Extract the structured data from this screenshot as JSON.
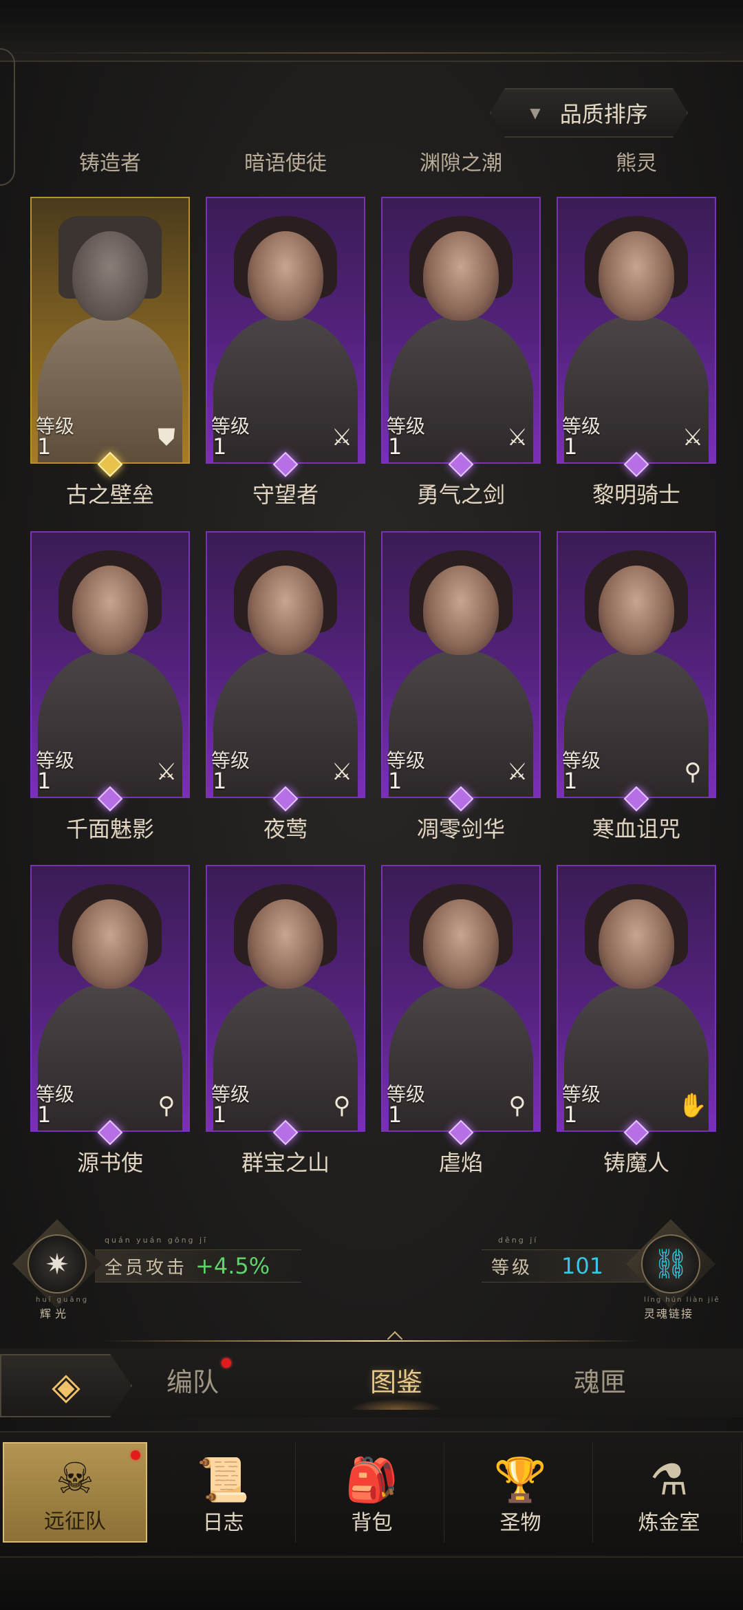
{
  "sort": {
    "label": "品质排序",
    "arrow": "▼"
  },
  "top_names": [
    "铸造者",
    "暗语使徒",
    "渊隙之潮",
    "熊灵"
  ],
  "heroes": [
    {
      "name": "古之壁垒",
      "level_label": "等级",
      "level": "1",
      "quality": "gold",
      "class_icon": "shield-icon",
      "glyph": "⛊"
    },
    {
      "name": "守望者",
      "level_label": "等级",
      "level": "1",
      "quality": "purple",
      "class_icon": "sword-icon",
      "glyph": "⚔"
    },
    {
      "name": "勇气之剑",
      "level_label": "等级",
      "level": "1",
      "quality": "purple",
      "class_icon": "sword-icon",
      "glyph": "⚔"
    },
    {
      "name": "黎明骑士",
      "level_label": "等级",
      "level": "1",
      "quality": "purple",
      "class_icon": "sword-icon",
      "glyph": "⚔"
    },
    {
      "name": "千面魅影",
      "level_label": "等级",
      "level": "1",
      "quality": "purple",
      "class_icon": "sword-icon",
      "glyph": "⚔"
    },
    {
      "name": "夜莺",
      "level_label": "等级",
      "level": "1",
      "quality": "purple",
      "class_icon": "sword-icon",
      "glyph": "⚔"
    },
    {
      "name": "凋零剑华",
      "level_label": "等级",
      "level": "1",
      "quality": "purple",
      "class_icon": "sword-icon",
      "glyph": "⚔"
    },
    {
      "name": "寒血诅咒",
      "level_label": "等级",
      "level": "1",
      "quality": "purple",
      "class_icon": "staff-icon",
      "glyph": "⚲"
    },
    {
      "name": "源书使",
      "level_label": "等级",
      "level": "1",
      "quality": "purple",
      "class_icon": "staff-icon",
      "glyph": "⚲"
    },
    {
      "name": "群宝之山",
      "level_label": "等级",
      "level": "1",
      "quality": "purple",
      "class_icon": "staff-icon",
      "glyph": "⚲"
    },
    {
      "name": "虐焰",
      "level_label": "等级",
      "level": "1",
      "quality": "purple",
      "class_icon": "staff-icon",
      "glyph": "⚲"
    },
    {
      "name": "铸魔人",
      "level_label": "等级",
      "level": "1",
      "quality": "purple",
      "class_icon": "hand-icon",
      "glyph": "✋"
    }
  ],
  "stats": {
    "left_emblem_caption": "辉光",
    "left_emblem_pinyin": "huī guāng",
    "attack_label": "全员攻击",
    "attack_pinyin": "quán yuán gōng jī",
    "attack_value": "+4.5%",
    "level_label": "等级",
    "level_pinyin": "děng jí",
    "level_value": "101",
    "right_emblem_caption": "灵魂链接",
    "right_emblem_pinyin": "líng hún liàn jiē"
  },
  "tabs": [
    {
      "label": "编队",
      "active": false,
      "badge": true
    },
    {
      "label": "图鉴",
      "active": true,
      "badge": false
    },
    {
      "label": "魂匣",
      "active": false,
      "badge": false
    }
  ],
  "nav": [
    {
      "label": "远征队",
      "icon": "helmet-icon",
      "glyph": "☠",
      "active": true,
      "badge": true
    },
    {
      "label": "日志",
      "icon": "scroll-icon",
      "glyph": "📜",
      "active": false,
      "badge": false
    },
    {
      "label": "背包",
      "icon": "bag-icon",
      "glyph": "🎒",
      "active": false,
      "badge": false
    },
    {
      "label": "圣物",
      "icon": "chalice-icon",
      "glyph": "🏆",
      "active": false,
      "badge": false
    },
    {
      "label": "炼金室",
      "icon": "alchemy-icon",
      "glyph": "⚗",
      "active": false,
      "badge": false
    }
  ],
  "colors": {
    "accent_gold": "#e8c98b",
    "attack_green": "#5fd46a",
    "level_cyan": "#39c7e6",
    "badge_red": "#e21c1c",
    "purple_frame": "#7a32b6",
    "gold_frame": "#b8902e"
  }
}
